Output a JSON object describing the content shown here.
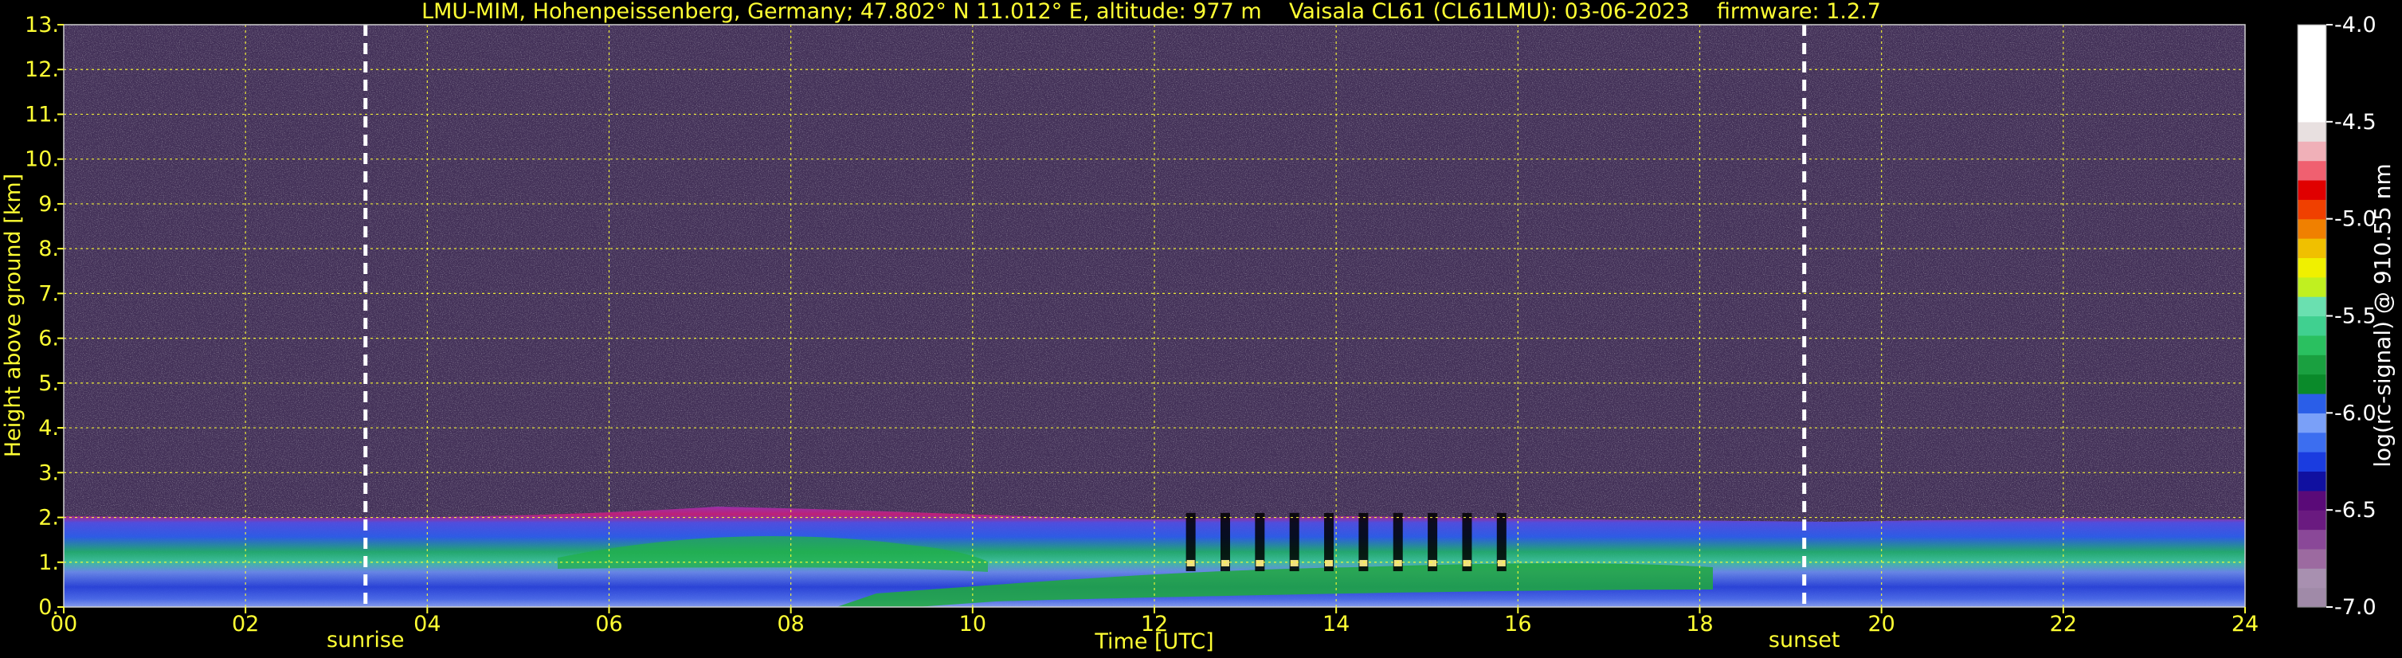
{
  "chart_data": {
    "type": "heatmap",
    "title": "LMU-MIM, Hohenpeissenberg, Germany; 47.802° N 11.012° E, altitude: 977 m    Vaisala CL61 (CL61LMU): 03-06-2023    firmware: 1.2.7",
    "xlabel": "Time [UTC]",
    "ylabel": "Height above ground [km]",
    "xlim": [
      0,
      24
    ],
    "ylim": [
      0,
      13
    ],
    "x_ticks": [
      0,
      2,
      4,
      6,
      8,
      10,
      12,
      14,
      16,
      18,
      20,
      22,
      24
    ],
    "x_tick_labels": [
      "00",
      "02",
      "04",
      "06",
      "08",
      "10",
      "12",
      "14",
      "16",
      "18",
      "20",
      "22",
      "24"
    ],
    "y_ticks": [
      0,
      1,
      2,
      3,
      4,
      5,
      6,
      7,
      8,
      9,
      10,
      11,
      12,
      13
    ],
    "y_tick_labels": [
      "0.",
      "1.",
      "2.",
      "3.",
      "4.",
      "5.",
      "6.",
      "7.",
      "8.",
      "9.",
      "10.",
      "11.",
      "12.",
      "13."
    ],
    "grid": true,
    "markers": [
      {
        "label": "sunrise",
        "x": 3.32
      },
      {
        "label": "sunset",
        "x": 19.15
      }
    ],
    "colorbar": {
      "label": "log(rc-signal) @ 910.55 nm",
      "range": [
        -7.0,
        -4.0
      ],
      "ticks": [
        -7.0,
        -6.5,
        -6.0,
        -5.5,
        -5.0,
        -4.5,
        -4.0
      ],
      "tick_labels": [
        "-7.0",
        "-6.5",
        "-6.0",
        "-5.5",
        "-5.0",
        "-4.5",
        "-4.0"
      ]
    },
    "features": {
      "boundary_layer_top_km": 2.0,
      "cloud_base_km": 1.0,
      "cloud_period_utc": [
        12.0,
        16.0
      ]
    }
  },
  "colors": {
    "text": "#ffff33",
    "grid": "#ffff33",
    "background": "#000000",
    "noise": "#6a4a8a",
    "marker": "#ffffff"
  }
}
